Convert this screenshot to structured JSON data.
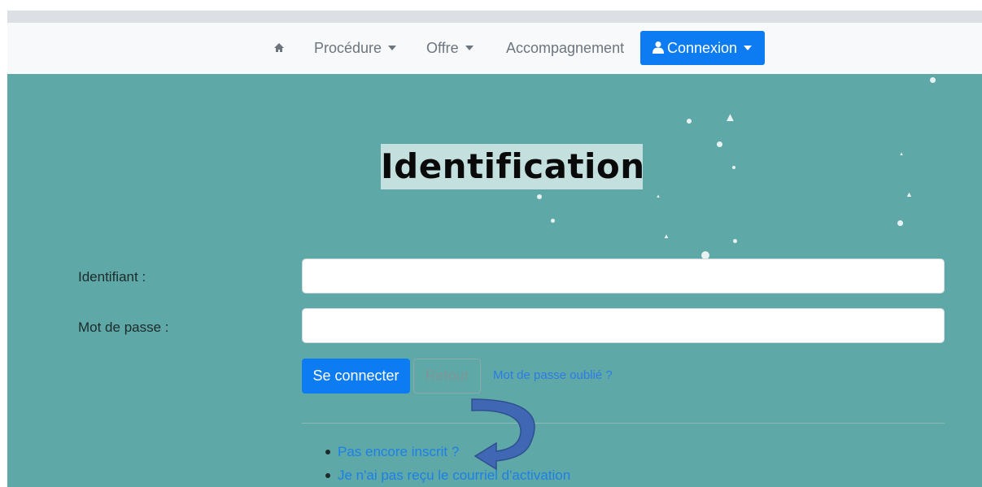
{
  "navbar": {
    "home_icon": "home-icon",
    "items": [
      {
        "label": "Procédure",
        "has_dropdown": true
      },
      {
        "label": "Offre",
        "has_dropdown": true
      },
      {
        "label": "Accompagnement",
        "has_dropdown": false
      }
    ],
    "connexion": {
      "label": "Connexion",
      "icon": "user-icon",
      "has_dropdown": true
    }
  },
  "page": {
    "title": "Identification",
    "background_color": "#5fa8a8"
  },
  "form": {
    "username_label": "Identifiant :",
    "username_value": "",
    "password_label": "Mot de passe :",
    "password_value": "",
    "submit_label": "Se connecter",
    "back_label": "Retour",
    "forgot_link": "Mot de passe oublié ?"
  },
  "links": [
    {
      "label": "Pas encore inscrit ?"
    },
    {
      "label": "Je n'ai pas reçu le courriel d'activation"
    }
  ],
  "annotation": {
    "icon": "curved-arrow-icon",
    "color": "#3f67b4"
  }
}
